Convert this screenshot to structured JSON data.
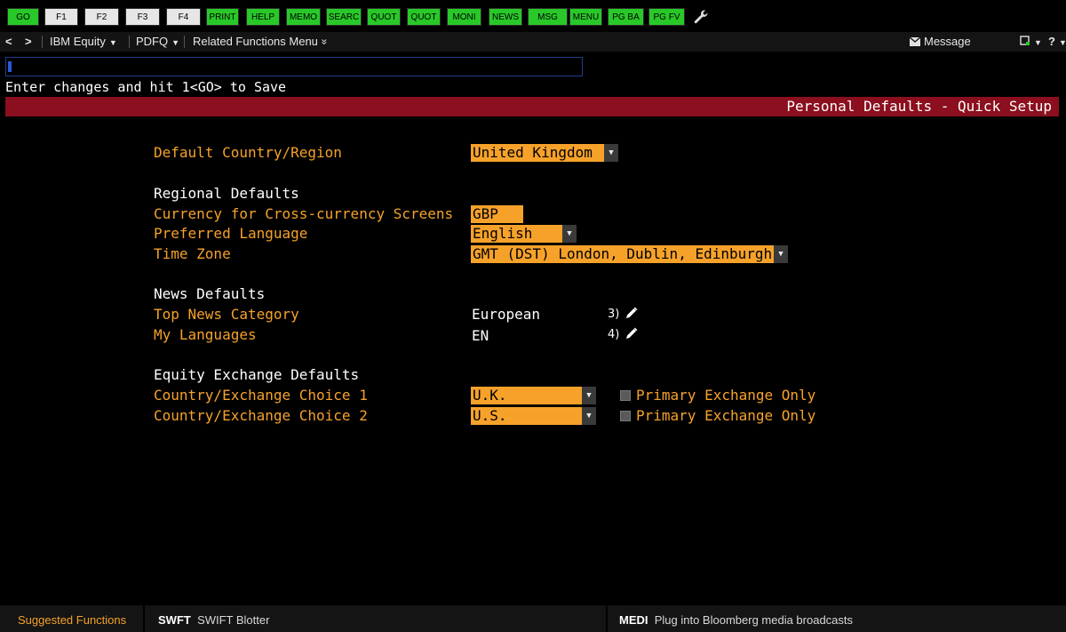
{
  "keys": [
    {
      "label": "GO",
      "style": "green"
    },
    {
      "label": "F1",
      "style": "gray"
    },
    {
      "label": "F2",
      "style": "gray"
    },
    {
      "label": "F3",
      "style": "gray"
    },
    {
      "label": "F4",
      "style": "gray"
    },
    {
      "label": "PRINT",
      "style": "green"
    },
    {
      "label": "HELP",
      "style": "green"
    },
    {
      "label": "MEMO",
      "style": "green"
    },
    {
      "label": "SEARC",
      "style": "green"
    },
    {
      "label": "QUOT",
      "style": "green"
    },
    {
      "label": "QUOT",
      "style": "green"
    },
    {
      "label": "MONI",
      "style": "green"
    },
    {
      "label": "NEWS",
      "style": "green"
    },
    {
      "label": "MSG",
      "style": "green"
    },
    {
      "label": "MENU",
      "style": "green"
    },
    {
      "label": "PG BA",
      "style": "green"
    },
    {
      "label": "PG FV",
      "style": "green"
    }
  ],
  "nav": {
    "back": "<",
    "forward": ">",
    "security": "IBM Equity",
    "function": "PDFQ",
    "related": "Related Functions Menu",
    "related_caret": "»",
    "message": "Message",
    "help": "?"
  },
  "command": {
    "hint": "Enter changes and hit 1<GO> to Save"
  },
  "title": "Personal Defaults - Quick Setup",
  "form": {
    "country_label": "Default Country/Region",
    "country_value": "United Kingdom",
    "regional_heading": "Regional Defaults",
    "currency_label": "Currency for Cross-currency Screens",
    "currency_value": "GBP",
    "language_label": "Preferred Language",
    "language_value": "English",
    "timezone_label": "Time Zone",
    "timezone_value": "GMT (DST) London, Dublin, Edinburgh, Li",
    "news_heading": "News Defaults",
    "topnews_label": "Top News Category",
    "topnews_value": "European",
    "topnews_num": "3)",
    "mylang_label": "My Languages",
    "mylang_value": "EN",
    "mylang_num": "4)",
    "equity_heading": "Equity Exchange Defaults",
    "choice1_label": "Country/Exchange Choice 1",
    "choice1_value": "U.K.",
    "choice2_label": "Country/Exchange Choice 2",
    "choice2_value": "U.S.",
    "primary_only_label": "Primary Exchange Only"
  },
  "bottom": {
    "suggested": "Suggested Functions",
    "fn1_mnemonic": "SWFT",
    "fn1_desc": "SWIFT Blotter",
    "fn2_mnemonic": "MEDI",
    "fn2_desc": "Plug into Bloomberg media broadcasts"
  },
  "colors": {
    "accent_orange": "#f6a22a",
    "title_red": "#8b0f1e",
    "key_green": "#29c829"
  }
}
